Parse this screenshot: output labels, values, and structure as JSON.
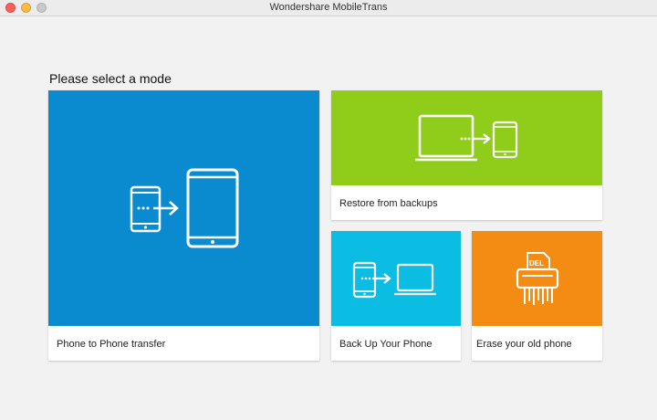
{
  "window": {
    "title": "Wondershare MobileTrans"
  },
  "heading": "Please select a mode",
  "modes": [
    {
      "label": "Phone to Phone transfer",
      "color": "#0a8bcf",
      "icon": "phone-to-phone-icon"
    },
    {
      "label": "Restore from backups",
      "color": "#8fcd1a",
      "icon": "laptop-to-phone-icon"
    },
    {
      "label": "Back Up Your Phone",
      "color": "#0bbce3",
      "icon": "phone-to-laptop-icon"
    },
    {
      "label": "Erase your old phone",
      "color": "#f48c13",
      "icon": "shredder-icon"
    }
  ],
  "erase_icon_text": "DEL"
}
